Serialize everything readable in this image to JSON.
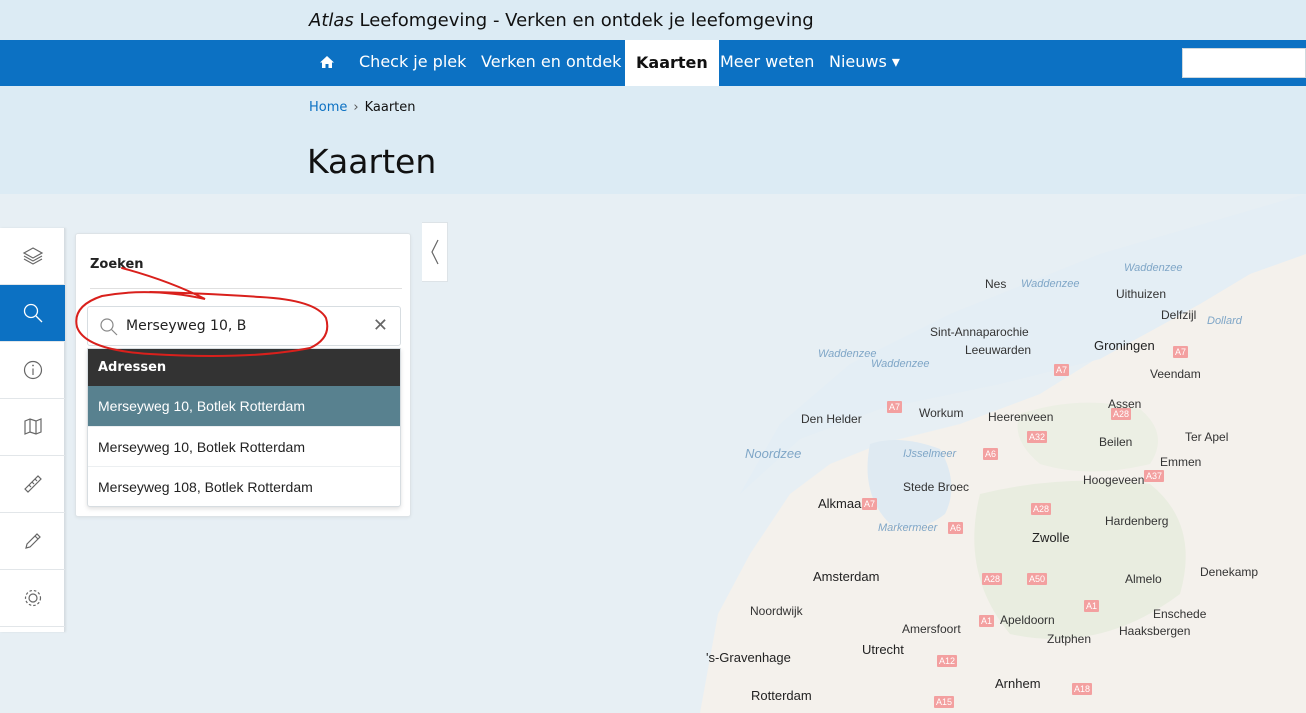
{
  "site": {
    "title_italic": "Atlas",
    "title_rest": " Leefomgeving - Verken en ontdek je leefomgeving"
  },
  "nav": {
    "home_icon": "home-icon",
    "items": [
      {
        "label": "Check je plek"
      },
      {
        "label": "Verken en ontdek"
      },
      {
        "label": "Kaarten"
      },
      {
        "label": "Meer weten"
      },
      {
        "label": "Nieuws ▾"
      }
    ],
    "active_item": "Kaarten"
  },
  "breadcrumb": {
    "home": "Home",
    "separator": "›",
    "current": "Kaarten"
  },
  "page_title": "Kaarten",
  "rail": {
    "buttons": [
      {
        "icon": "layers-icon"
      },
      {
        "icon": "search-icon"
      },
      {
        "icon": "info-icon"
      },
      {
        "icon": "map-legend-icon"
      },
      {
        "icon": "ruler-icon"
      },
      {
        "icon": "pencil-icon"
      },
      {
        "icon": "settings-icon"
      }
    ],
    "active_index": 1
  },
  "search_panel": {
    "heading": "Zoeken",
    "input_value": "Merseyweg 10, B",
    "clear": "✕",
    "results_header": "Adressen",
    "results": [
      "Merseyweg 10, Botlek Rotterdam",
      "Merseyweg 10, Botlek Rotterdam",
      "Merseyweg 108, Botlek Rotterdam"
    ],
    "selected_index": 0,
    "collapse_icon": "chevron-left-icon"
  },
  "map": {
    "places": [
      {
        "name": "Nes"
      },
      {
        "name": "Uithuizen"
      },
      {
        "name": "Delfzijl"
      },
      {
        "name": "Sint-Annaparochie"
      },
      {
        "name": "Groningen"
      },
      {
        "name": "Leeuwarden"
      },
      {
        "name": "Veendam"
      },
      {
        "name": "Assen"
      },
      {
        "name": "Den Helder"
      },
      {
        "name": "Workum"
      },
      {
        "name": "Heerenveen"
      },
      {
        "name": "Beilen"
      },
      {
        "name": "Ter Apel"
      },
      {
        "name": "Emmen"
      },
      {
        "name": "Hoogeveen"
      },
      {
        "name": "Stede Broec"
      },
      {
        "name": "Alkmaar"
      },
      {
        "name": "Hardenberg"
      },
      {
        "name": "Zwolle"
      },
      {
        "name": "Amsterdam"
      },
      {
        "name": "Almelo"
      },
      {
        "name": "Denekamp"
      },
      {
        "name": "Noordwijk"
      },
      {
        "name": "Enschede"
      },
      {
        "name": "Apeldoorn"
      },
      {
        "name": "Amersfoort"
      },
      {
        "name": "Zutphen"
      },
      {
        "name": "Haaksbergen"
      },
      {
        "name": "Utrecht"
      },
      {
        "name": "'s-Gravenhage"
      },
      {
        "name": "Arnhem"
      },
      {
        "name": "Rotterdam"
      }
    ],
    "water": [
      "Waddenzee",
      "Waddenzee",
      "Dollard",
      "Waddenzee",
      "Waddenzee",
      "IJsselmeer",
      "Markermeer"
    ],
    "sea": "Noordzee",
    "roads": [
      "A7",
      "A7",
      "A28",
      "A7",
      "A32",
      "A6",
      "A37",
      "A7",
      "A28",
      "A6",
      "A28",
      "A50",
      "A1",
      "A1",
      "A12",
      "A18",
      "A15"
    ]
  },
  "colors": {
    "brand_blue": "#0c71c3",
    "header_bg": "#dcebf4",
    "selected_row": "#58818f",
    "results_header": "#333333",
    "annotation_red": "#d9201c"
  }
}
